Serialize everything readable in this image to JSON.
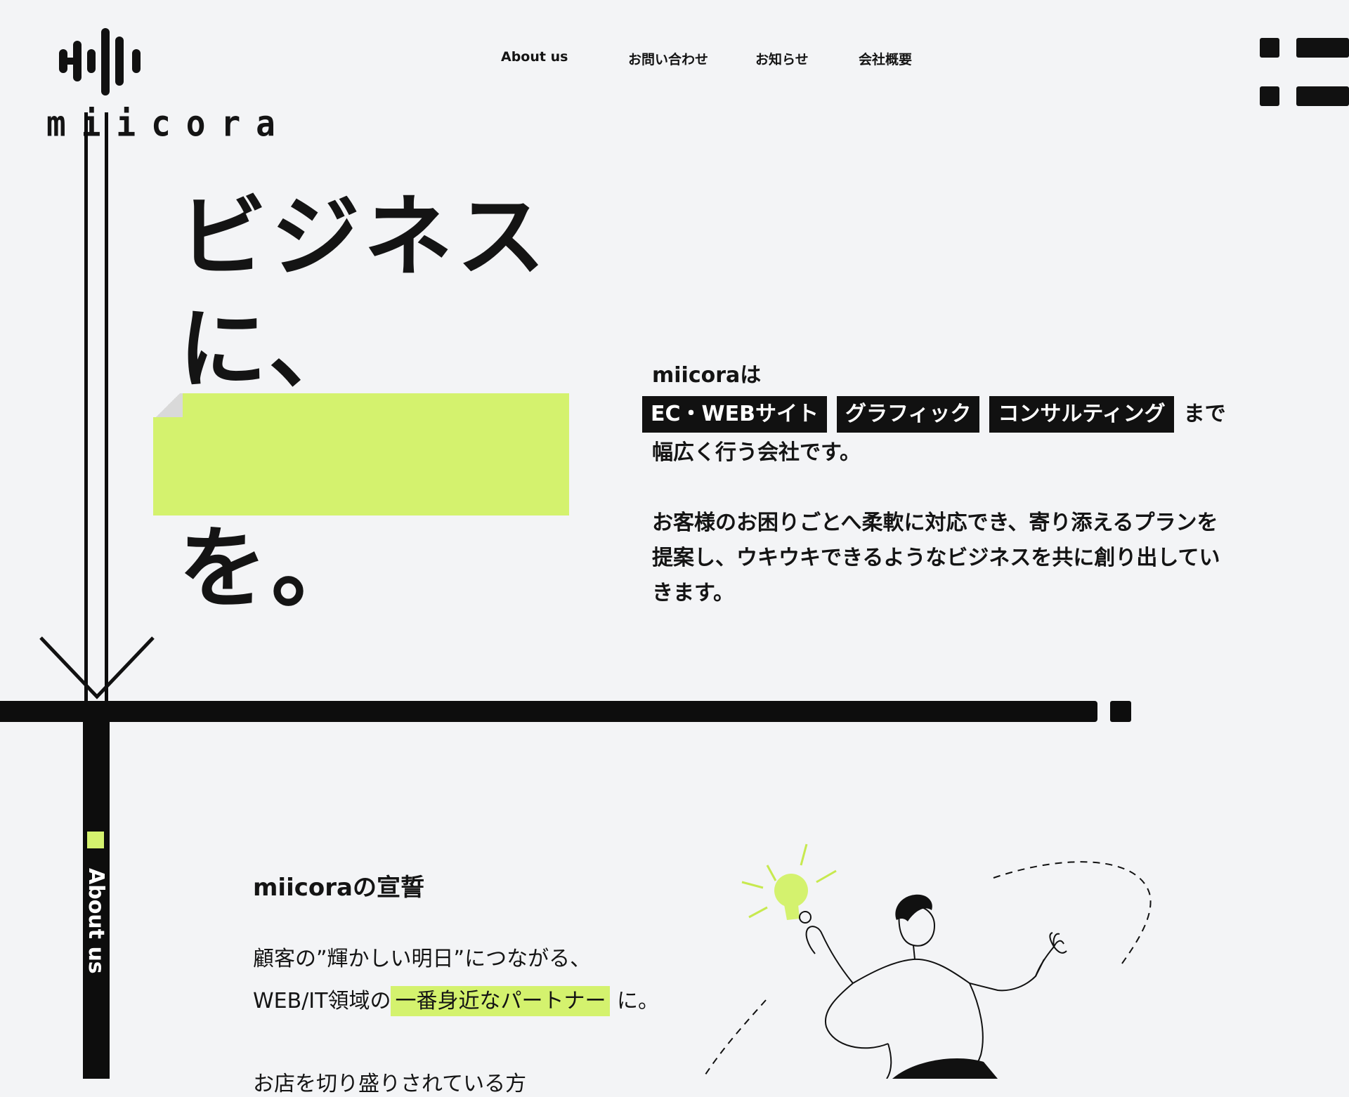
{
  "brand": {
    "name": "miicora"
  },
  "nav": {
    "items": [
      "About us",
      "お問い合わせ",
      "お知らせ",
      "会社概要"
    ]
  },
  "menu": {
    "icon": "hamburger-menu-icon"
  },
  "hero": {
    "line1": "ビジネスに、",
    "line1a": "ビジネス",
    "line1b": "に、",
    "line3": "を。"
  },
  "intro": {
    "lead": "miicoraは",
    "tags": [
      "EC・WEBサイト",
      "グラフィック",
      "コンサルティング"
    ],
    "after_tags": "まで",
    "line3": "幅広く行う会社です。",
    "para2_line1": "お客様のお困りごとへ柔軟に対応でき、寄り添えるプランを",
    "para2_line2": "提案し、ウキウキできるようなビジネスを共に創り出してい",
    "para2_line3": "きます。"
  },
  "about": {
    "side_label": "About us",
    "heading": "miicoraの宣誓",
    "line1": "顧客の”輝かしい明日”につながる、",
    "line2_pre": "WEB/IT領域の",
    "line2_highlight": "一番身近なパートナー",
    "line2_post": "に。",
    "line3_partial": "お店を切り盛りされている方"
  },
  "colors": {
    "background": "#f3f4f6",
    "ink": "#0d0d0d",
    "accent": "#d4f26e"
  },
  "icons": [
    "logo-sound-bars-icon",
    "hamburger-menu-icon",
    "arrow-down-icon",
    "lightbulb-icon"
  ]
}
